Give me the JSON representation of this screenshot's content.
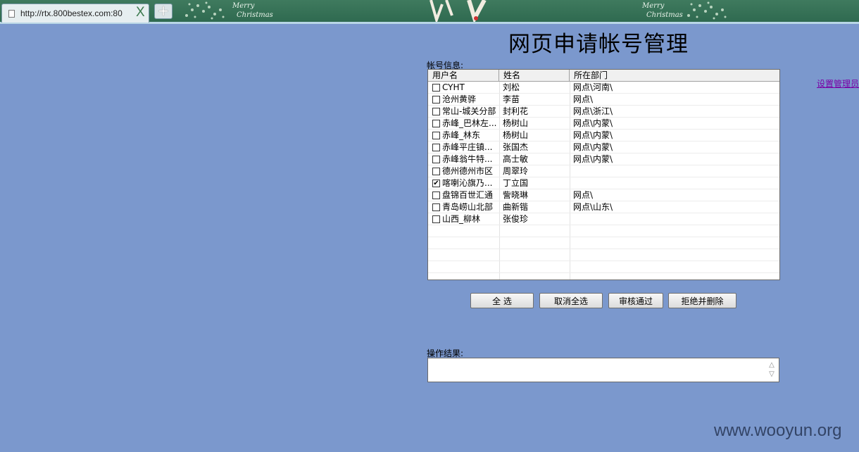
{
  "browser": {
    "tab_url": "http://rtx.800bestex.com:80",
    "tab_close": "X",
    "new_tab": "+",
    "decorations": [
      "Merry",
      "Christmas",
      "Merry",
      "Christmas"
    ]
  },
  "page": {
    "title": "网页申请帐号管理",
    "account_info_label": "帐号信息:",
    "admin_link": "设置管理员",
    "result_label": "操作结果:",
    "result_value": ""
  },
  "table": {
    "columns": [
      "用户名",
      "姓名",
      "所在部门"
    ],
    "rows": [
      {
        "username": "CYHT",
        "name": "刘松",
        "dept": "网点\\河南\\",
        "checked": false
      },
      {
        "username": "沧州黄骅",
        "name": "李苗",
        "dept": "网点\\",
        "checked": false
      },
      {
        "username": "常山-城关分部",
        "name": "封利花",
        "dept": "网点\\浙江\\",
        "checked": false
      },
      {
        "username": "赤峰_巴林左...",
        "name": "杨树山",
        "dept": "网点\\内蒙\\",
        "checked": false
      },
      {
        "username": "赤峰_林东",
        "name": "杨树山",
        "dept": "网点\\内蒙\\",
        "checked": false
      },
      {
        "username": "赤峰平庄镇...",
        "name": "张国杰",
        "dept": "网点\\内蒙\\",
        "checked": false
      },
      {
        "username": "赤峰翁牛特...",
        "name": "高士敏",
        "dept": "网点\\内蒙\\",
        "checked": false
      },
      {
        "username": "德州德州市区",
        "name": "周翠玲",
        "dept": "",
        "checked": false
      },
      {
        "username": "喀喇沁旗乃...",
        "name": "丁立国",
        "dept": "",
        "checked": true
      },
      {
        "username": "盘锦百世汇通",
        "name": "訾晓琳",
        "dept": "网点\\",
        "checked": false
      },
      {
        "username": "青岛崂山北部",
        "name": "曲新锴",
        "dept": "网点\\山东\\",
        "checked": false
      },
      {
        "username": "山西_柳林",
        "name": "张俊珍",
        "dept": "",
        "checked": false
      }
    ]
  },
  "buttons": {
    "select_all": "全 选",
    "deselect_all": "取消全选",
    "approve": "审核通过",
    "reject_delete": "拒绝并删除"
  },
  "watermark": "www.wooyun.org"
}
